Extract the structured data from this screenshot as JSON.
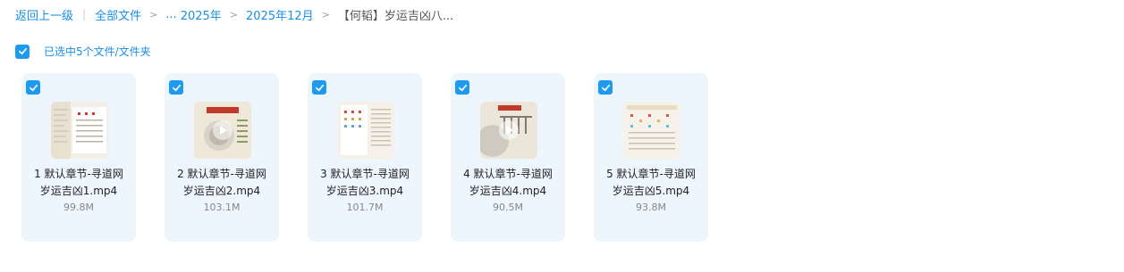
{
  "breadcrumb": {
    "back": "返回上一级",
    "all_files": "全部文件",
    "ellipsis": "...",
    "year": "2025年",
    "month": "2025年12月",
    "current": "【何韬】岁运吉凶八..."
  },
  "selection": {
    "text": "已选中5个文件/文件夹",
    "checked": true
  },
  "files": [
    {
      "line1": "1 默认章节-寻道网",
      "line2": "岁运吉凶1.mp4",
      "size": "99.8M",
      "checked": true,
      "play_icon": false
    },
    {
      "line1": "2 默认章节-寻道网",
      "line2": "岁运吉凶2.mp4",
      "size": "103.1M",
      "checked": true,
      "play_icon": true
    },
    {
      "line1": "3 默认章节-寻道网",
      "line2": "岁运吉凶3.mp4",
      "size": "101.7M",
      "checked": true,
      "play_icon": false
    },
    {
      "line1": "4 默认章节-寻道网",
      "line2": "岁运吉凶4.mp4",
      "size": "90.5M",
      "checked": true,
      "play_icon": true
    },
    {
      "line1": "5 默认章节-寻道网",
      "line2": "岁运吉凶5.mp4",
      "size": "93.8M",
      "checked": true,
      "play_icon": false
    }
  ],
  "colors": {
    "accent": "#1e9bf0",
    "link": "#1a8ee6",
    "card_bg": "#eef6fd"
  }
}
